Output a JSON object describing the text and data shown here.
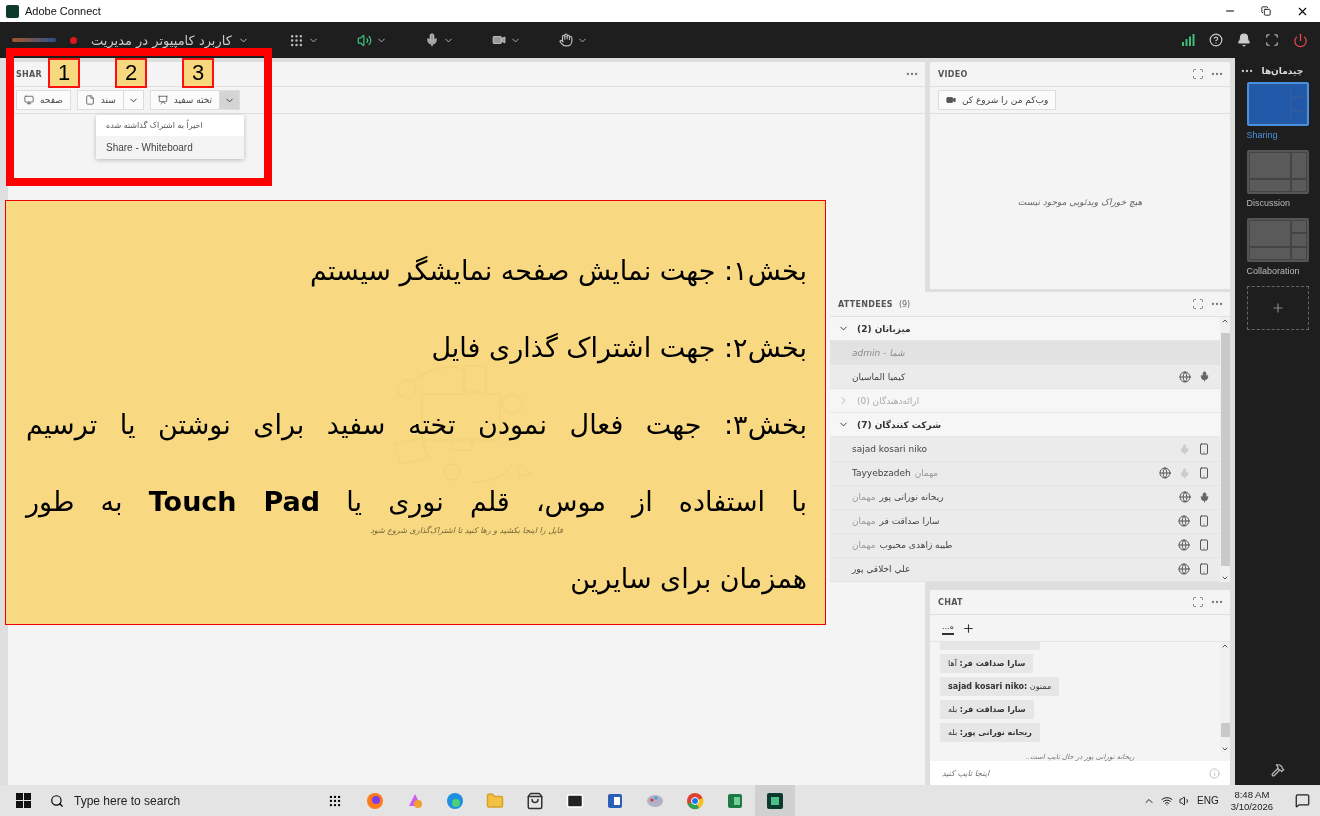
{
  "window": {
    "title": "Adobe Connect"
  },
  "meeting": {
    "name": "کاربرد کامپیوتر در مدیریت",
    "recording": true
  },
  "share_pod": {
    "title": "SHAR",
    "buttons": [
      {
        "label": "تخته سفید",
        "kind": "whiteboard",
        "menu": true,
        "open": true
      },
      {
        "label": "سند",
        "kind": "document",
        "menu": true,
        "open": false
      },
      {
        "label": "صفحه",
        "kind": "screen",
        "menu": false
      }
    ],
    "menu": {
      "header": "اخیراً به اشتراک گذاشته شده",
      "items": [
        "Share - Whiteboard"
      ]
    },
    "drop_hint": "فایل را اینجا بکشید و رها کنید تا اشتراک‌گذاری شروع شود"
  },
  "video_pod": {
    "title": "VIDEO",
    "start_button": "وب‌کم من را شروع کن",
    "empty": "هیچ خوراک ویدئویی موجود نیست"
  },
  "attendees_pod": {
    "title": "ATTENDEES",
    "count": "(9)",
    "groups": [
      {
        "title": "میزبانان (2)",
        "expanded": true,
        "disabled": false,
        "members": [
          {
            "kind": "self",
            "name": "admin - شما",
            "globe": false,
            "mic": false,
            "phone": false
          },
          {
            "kind": "user",
            "name": "کیمیا الماسیان",
            "globe": true,
            "mic": true,
            "muted": false,
            "phone": false
          }
        ]
      },
      {
        "title": "ارائه‌دهندگان (0)",
        "expanded": false,
        "disabled": true
      },
      {
        "title": "شرکت کنندگان (7)",
        "expanded": true,
        "disabled": false,
        "members": [
          {
            "kind": "user",
            "name": "sajad kosari niko",
            "globe": false,
            "mic": true,
            "muted": true,
            "phone": true
          },
          {
            "kind": "guest",
            "name": "Tayyebzadeh",
            "tag": "مهمان",
            "tag_first": false,
            "globe": true,
            "mic": true,
            "muted": true,
            "phone": true
          },
          {
            "kind": "guest",
            "name": "ریحانه نورانی پور",
            "tag": "مهمان",
            "tag_first": true,
            "globe": true,
            "mic": true,
            "muted": false,
            "phone": false
          },
          {
            "kind": "guest",
            "name": "سارا صداقت فر",
            "tag": "مهمان",
            "tag_first": true,
            "globe": true,
            "mic": false,
            "phone": true
          },
          {
            "kind": "guest",
            "name": "طیبه زاهدی محبوب",
            "tag": "مهمان",
            "tag_first": true,
            "globe": true,
            "mic": false,
            "phone": true
          },
          {
            "kind": "user",
            "name": "علي اخلاقي پور",
            "globe": true,
            "mic": false,
            "phone": true
          }
        ]
      }
    ]
  },
  "chat_pod": {
    "title": "CHAT",
    "tab": "ه...",
    "messages": [
      {
        "sender": "سارا صداقت فر:",
        "text": "آها"
      },
      {
        "sender": "sajad kosari niko:",
        "text": "ممنون"
      },
      {
        "sender": "سارا صداقت فر:",
        "text": "بله"
      },
      {
        "sender": "ریحانه نورانی پور:",
        "text": "بله"
      }
    ],
    "typing": "ریحانه نورانی پور در حال تایپ است..",
    "placeholder": "اینجا تایپ کنید"
  },
  "layouts": {
    "title": "چیدمان‌ها",
    "items": [
      {
        "label": "Sharing",
        "kind": "sharing",
        "selected": true
      },
      {
        "label": "Discussion",
        "kind": "discussion",
        "selected": false
      },
      {
        "label": "Collaboration",
        "kind": "collaboration",
        "selected": false
      }
    ]
  },
  "annotations": {
    "badges": [
      "3",
      "2",
      "1"
    ],
    "lines": [
      {
        "text": "بخش۱: جهت نمایش صفحه نمایشگر سیستم",
        "justify": false
      },
      {
        "text": "بخش۲: جهت اشتراک گذاری فایل",
        "justify": false
      },
      {
        "text": "بخش۳: جهت فعال نمودن تخته سفید برای نوشتن یا ترسیم",
        "justify": true
      },
      {
        "text": "با استفاده از موس، قلم نوری یا **Touch Pad** به طور",
        "justify": true
      },
      {
        "text": "همزمان برای سایرین",
        "justify": false
      }
    ]
  },
  "taskbar": {
    "search_placeholder": "Type here to search",
    "language": "ENG",
    "time": "8:48 AM",
    "date": "3/10/2026"
  }
}
